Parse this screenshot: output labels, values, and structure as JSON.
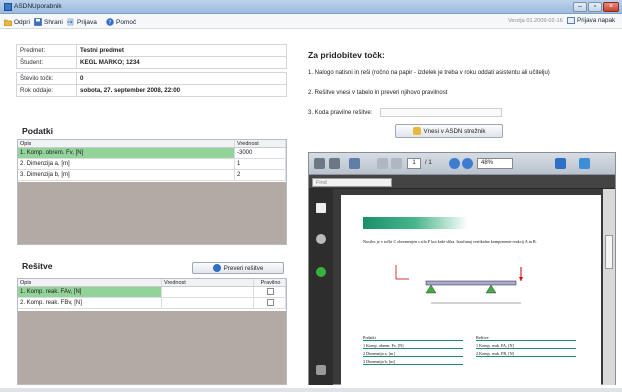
{
  "window": {
    "title": "ASDNUporabnik"
  },
  "menu": {
    "items": [
      {
        "label": "Odpri",
        "icon": "folder-open-icon"
      },
      {
        "label": "Shrani",
        "icon": "save-disk-icon"
      },
      {
        "label": "Prijava",
        "icon": "login-icon"
      },
      {
        "label": "Pomoč",
        "icon": "help-icon"
      }
    ],
    "version": "Verzija 01.2009-02-16",
    "report_bugs": "Prijava napak"
  },
  "info": {
    "rows": [
      {
        "label": "Predmet:",
        "value": "Testni predmet"
      },
      {
        "label": "Študent:",
        "value": "KEGL MARKO; 1234"
      },
      {
        "label": "Število točk:",
        "value": "0"
      },
      {
        "label": "Rok oddaje:",
        "value": "sobota, 27. september 2008,  22:00"
      }
    ]
  },
  "podatki": {
    "title": "Podatki",
    "columns": [
      "Opis",
      "Vrednost"
    ],
    "rows": [
      {
        "opis": "1. Komp. obrem. Fv, [N]",
        "vrednost": "-3000"
      },
      {
        "opis": "2. Dimenzija a, [m]",
        "vrednost": "1"
      },
      {
        "opis": "3. Dimenzija b, [m]",
        "vrednost": "2"
      }
    ]
  },
  "resitve": {
    "title": "Rešitve",
    "check_button": "Preveri rešitve",
    "columns": [
      "Opis",
      "Vrednost",
      "Pravilno"
    ],
    "rows": [
      {
        "opis": "1. Komp. reak. FAv, [N]",
        "vrednost": ""
      },
      {
        "opis": "2. Komp. reak. FBv, [N]",
        "vrednost": ""
      }
    ]
  },
  "instructions": {
    "title": "Za pridobitev točk:",
    "step1": "1. Nalogo natisni in reši (ročno na papir - izdelek je treba v roku oddati asistentu ali učitelju)",
    "step2": "2. Rešitve vnesi v tabelo in preveri njihovo pravilnost",
    "step3_label": "3. Koda pravilne rešitve:",
    "step3_value": "",
    "submit_button": "Vnesi v ASDN strežnik"
  },
  "viewer": {
    "page_current": "1",
    "page_total": "/ 1",
    "zoom": "48%",
    "find_placeholder": "Find",
    "pdf_text": "Nosilec je v točki C obremenjen s silo F kot kaže slika. Izračunaj vertikalne komponente reakcij A in B.",
    "pdf_col1": "Podatki",
    "pdf_col2": "Rešitve",
    "pdf_rows1": [
      "1 Komp. obrem. Fv, [N]",
      "2 Dimenzija a, [m]",
      "3 Dimenzija b, [m]"
    ],
    "pdf_rows2": [
      "1 Komp. reak. FA, [N]",
      "2 Komp. reak. FB, [N]"
    ]
  },
  "colors": {
    "selected_row": "#92d399",
    "filler": "#b3aaa6",
    "accent": "#3a78c8"
  }
}
